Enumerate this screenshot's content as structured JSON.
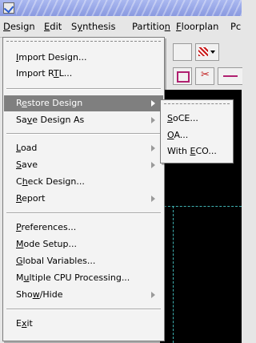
{
  "menubar": {
    "items": [
      {
        "pre": "",
        "u": "D",
        "post": "esign"
      },
      {
        "pre": "",
        "u": "E",
        "post": "dit"
      },
      {
        "pre": "S",
        "u": "y",
        "post": "nthesis"
      },
      {
        "pre": "Partitio",
        "u": "n",
        "post": ""
      },
      {
        "pre": "",
        "u": "F",
        "post": "loorplan"
      },
      {
        "pre": "Pc",
        "u": "",
        "post": ""
      }
    ]
  },
  "design_menu": {
    "groups": [
      [
        {
          "pre": "",
          "u": "I",
          "post": "mport Design...",
          "submenu": false
        },
        {
          "pre": "Import R",
          "u": "T",
          "post": "L...",
          "submenu": false
        }
      ],
      [
        {
          "pre": "R",
          "u": "e",
          "post": "store Design",
          "submenu": true,
          "selected": true
        },
        {
          "pre": "Sa",
          "u": "v",
          "post": "e Design As",
          "submenu": true
        }
      ],
      [
        {
          "pre": "",
          "u": "L",
          "post": "oad",
          "submenu": true
        },
        {
          "pre": "",
          "u": "S",
          "post": "ave",
          "submenu": true
        },
        {
          "pre": "C",
          "u": "h",
          "post": "eck Design...",
          "submenu": false
        },
        {
          "pre": "",
          "u": "R",
          "post": "eport",
          "submenu": true
        }
      ],
      [
        {
          "pre": "",
          "u": "P",
          "post": "references...",
          "submenu": false
        },
        {
          "pre": "",
          "u": "M",
          "post": "ode Setup...",
          "submenu": false
        },
        {
          "pre": "",
          "u": "G",
          "post": "lobal Variables...",
          "submenu": false
        },
        {
          "pre": "M",
          "u": "u",
          "post": "ltiple CPU Processing...",
          "submenu": false
        },
        {
          "pre": "Sho",
          "u": "w",
          "post": "/Hide",
          "submenu": true
        }
      ],
      [
        {
          "pre": "E",
          "u": "x",
          "post": "it",
          "submenu": false
        }
      ]
    ]
  },
  "restore_submenu": {
    "items": [
      {
        "pre": "",
        "u": "S",
        "post": "oCE..."
      },
      {
        "pre": "",
        "u": "O",
        "post": "A..."
      },
      {
        "pre": "With ",
        "u": "E",
        "post": "CO..."
      }
    ]
  },
  "colors": {
    "selected_bg": "#7f7f7f",
    "canvas": "#000000",
    "guide": "#3fb0b0"
  }
}
